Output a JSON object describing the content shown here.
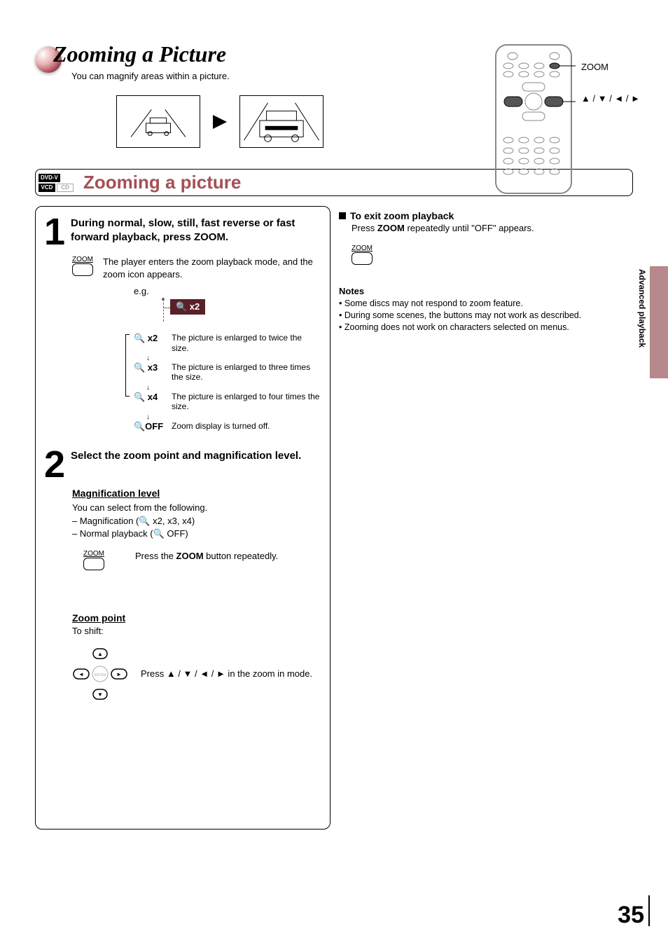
{
  "header": {
    "title": "Zooming a Picture",
    "subtitle": "You can magnify areas within a picture."
  },
  "remote": {
    "label_zoom": "ZOOM",
    "label_arrows": "▲ / ▼ / ◄ / ►"
  },
  "section": {
    "tags": {
      "dvd_v": "DVD-V",
      "vcd": "VCD",
      "cd": "CD"
    },
    "title": "Zooming a picture"
  },
  "steps": {
    "s1": {
      "num": "1",
      "head": "During normal, slow, still, fast reverse or fast forward playback, press ZOOM.",
      "key_label": "ZOOM",
      "desc": "The player enters the zoom playback mode, and the zoom icon appears.",
      "eg": "e.g.",
      "osd": "🔍 x2",
      "levels": [
        {
          "k": "🔍 x2",
          "v": "The picture is enlarged to twice the size."
        },
        {
          "k": "🔍 x3",
          "v": "The picture is enlarged to three times the size."
        },
        {
          "k": "🔍 x4",
          "v": "The picture is enlarged to four times the size."
        },
        {
          "k": "🔍OFF",
          "v": "Zoom display is turned off."
        }
      ]
    },
    "s2": {
      "num": "2",
      "head": "Select the zoom point and magnification level.",
      "mag_head": "Magnification level",
      "mag_body1": "You can select from the following.",
      "mag_body2": "– Magnification (🔍 x2, x3, x4)",
      "mag_body3": "– Normal playback (🔍 OFF)",
      "zoom_key_label": "ZOOM",
      "zoom_key_desc": "Press the ZOOM button repeatedly.",
      "zp_head": "Zoom point",
      "zp_shift": "To shift:",
      "zp_desc": "Press ▲ / ▼ / ◄ / ► in the zoom in mode."
    }
  },
  "right": {
    "exit_head": "To exit zoom playback",
    "exit_body": "Press ZOOM repeatedly until \"OFF\" appears.",
    "exit_key_label": "ZOOM",
    "notes_head": "Notes",
    "notes": [
      "Some discs may not respond to zoom feature.",
      "During some scenes, the buttons may not work as described.",
      "Zooming does not work on characters selected on menus."
    ]
  },
  "side": {
    "label": "Advanced playback"
  },
  "page_number": "35"
}
